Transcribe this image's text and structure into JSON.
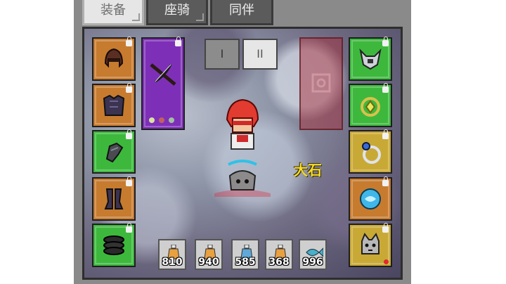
{
  "tabs": [
    {
      "label": "装备",
      "active": true
    },
    {
      "label": "座骑",
      "active": false
    },
    {
      "label": "同伴",
      "active": false
    }
  ],
  "mode_buttons": [
    {
      "label": "I",
      "selected": false
    },
    {
      "label": "II",
      "selected": true
    }
  ],
  "character": {
    "name": "大石"
  },
  "left_slots": [
    {
      "item": "helmet-icon",
      "rarity": "orange",
      "locked": true
    },
    {
      "item": "chest-armor-icon",
      "rarity": "orange",
      "locked": true
    },
    {
      "item": "gloves-icon",
      "rarity": "green",
      "locked": true
    },
    {
      "item": "leg-armor-icon",
      "rarity": "orange",
      "locked": true
    },
    {
      "item": "boots-icon",
      "rarity": "green",
      "locked": true
    }
  ],
  "weapon_slot": {
    "item": "crossbow-icon",
    "rarity": "purple",
    "locked": true
  },
  "right_slots": [
    {
      "item": "necklace-icon",
      "rarity": "green",
      "locked": true
    },
    {
      "item": "amulet-icon",
      "rarity": "green",
      "locked": true
    },
    {
      "item": "ring-icon",
      "rarity": "gold",
      "locked": true
    },
    {
      "item": "orb-icon",
      "rarity": "orange",
      "locked": true
    },
    {
      "item": "pet-companion-icon",
      "rarity": "gold",
      "locked": true
    }
  ],
  "potions": [
    {
      "icon": "potion-icon",
      "count": "810"
    },
    {
      "icon": "potion-icon",
      "count": "940"
    },
    {
      "icon": "potion-icon",
      "count": "585"
    },
    {
      "icon": "potion-icon",
      "count": "368"
    },
    {
      "icon": "fish-icon",
      "count": "996"
    }
  ],
  "colors": {
    "orange_rarity": "#c77b2f",
    "green_rarity": "#3db83d",
    "gold_rarity": "#c9a936",
    "purple_rarity": "#7e2fb8",
    "name_color": "#f6dd2a"
  }
}
